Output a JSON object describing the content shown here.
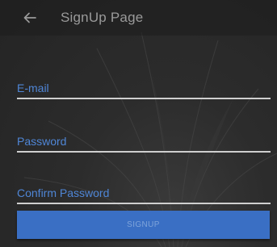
{
  "app_bar": {
    "back_icon": "arrow-left-icon",
    "title": "SignUp Page"
  },
  "form": {
    "email": {
      "placeholder": "E-mail",
      "value": ""
    },
    "password": {
      "placeholder": "Password",
      "value": ""
    },
    "confirm_password": {
      "placeholder": "Confirm Password",
      "value": ""
    },
    "submit_label": "SIGNUP"
  },
  "colors": {
    "accent": "#3a6fc4",
    "placeholder": "#4f86d6",
    "underline": "#cfcfcf",
    "background": "#2a2a2a"
  }
}
